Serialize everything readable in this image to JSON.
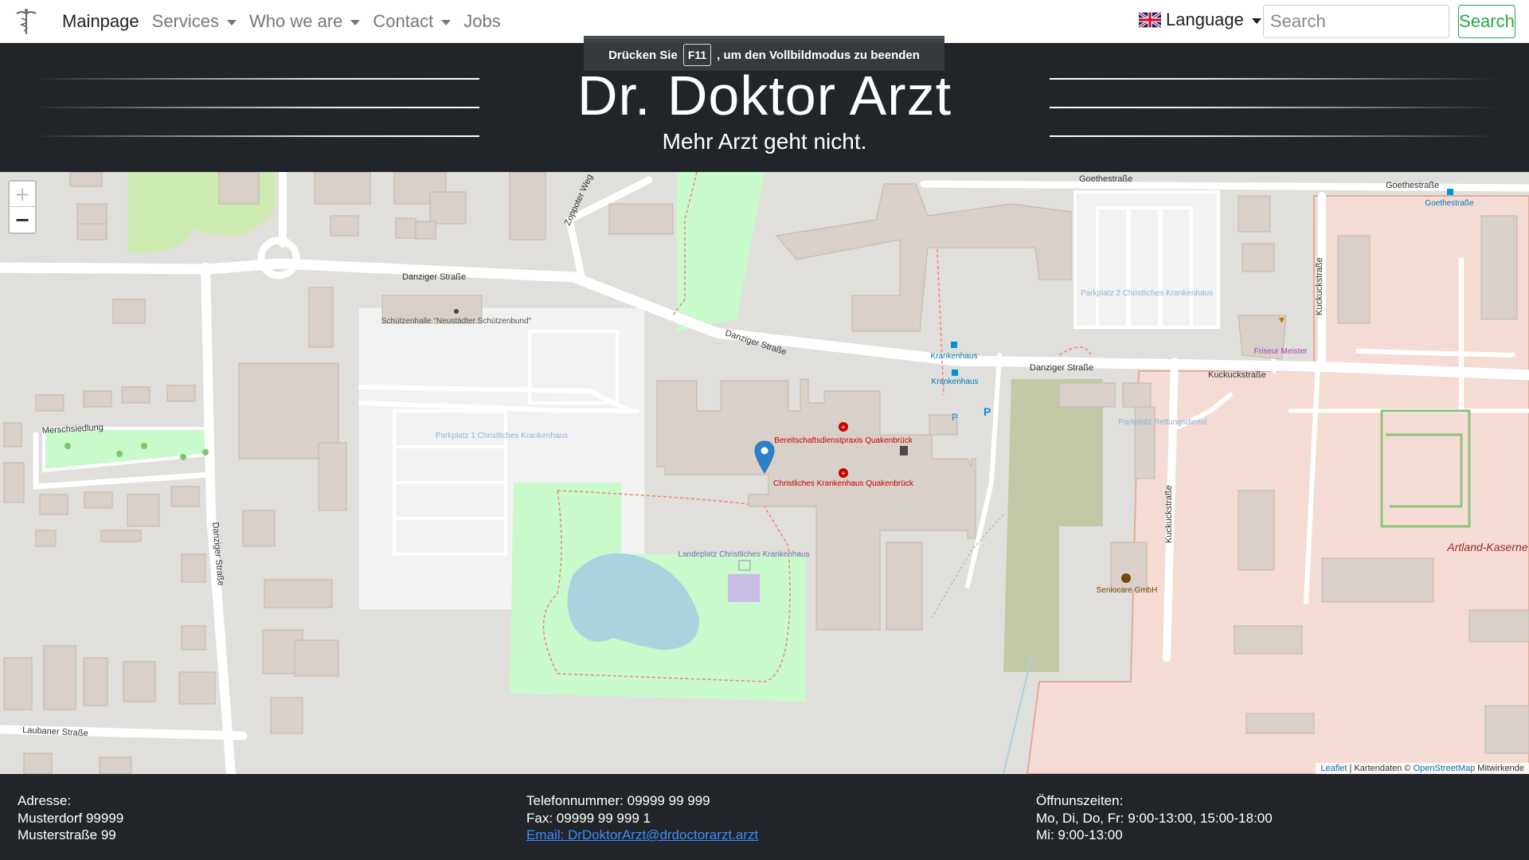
{
  "nav": {
    "brand_icon": "caduceus-icon",
    "items": [
      {
        "label": "Mainpage",
        "dropdown": false
      },
      {
        "label": "Services",
        "dropdown": true
      },
      {
        "label": "Who we are",
        "dropdown": true
      },
      {
        "label": "Contact",
        "dropdown": true
      },
      {
        "label": "Jobs",
        "dropdown": false
      }
    ],
    "language_label": "Language",
    "language_icon": "uk-flag-icon",
    "search_placeholder": "Search",
    "search_button": "Search"
  },
  "fullscreen_hint": {
    "before": "Drücken Sie",
    "key": "F11",
    "after": ", um den Vollbildmodus zu beenden"
  },
  "header": {
    "title": "Dr. Doktor Arzt",
    "subtitle": "Mehr Arzt geht nicht."
  },
  "map": {
    "zoom_in": "+",
    "zoom_out": "−",
    "marker_icon": "map-marker-icon",
    "labels": {
      "goethestrasse": "Goethestraße",
      "goethestrasse_stop": "Goethestraße",
      "danziger_strasse": "Danziger Straße",
      "zoppoter_weg": "Zoppoter Weg",
      "kuckuckstrasse": "Kuckuckstraße",
      "merschsiedlung": "Merschsiedlung",
      "laubaner_strasse": "Laubaner Straße",
      "schuetzenhalle": "Schützenhalle \"Neustädter Schützenbund\"",
      "parkplatz_1": "Parkplatz 1 Christliches Krankenhaus",
      "parkplatz_2": "Parkplatz 2 Christliches Krankenhaus",
      "parkplatz_rettung": "Parkplatz Rettungsdienst",
      "krankenhaus_stop": "Krankenhaus",
      "bereitschaft": "Bereitschaftsdienstpraxis Quakenbrück",
      "christliches_kh": "Christliches Krankenhaus Quakenbrück",
      "landeplatz": "Landeplatz Christliches Krankenhaus",
      "friseur": "Friseur Meister",
      "seniocare": "Seniocare GmbH",
      "kaserne": "Artland-Kaserne"
    },
    "attribution": {
      "leaflet": "Leaflet",
      "text": " | Kartendaten © ",
      "osm": "OpenStreetMap",
      "tail": " Mitwirkende"
    }
  },
  "footer": {
    "address_label": "Adresse:",
    "address_line1": "Musterdorf 99999",
    "address_line2": "Musterstraße 99",
    "phone": "Telefonnummer: 09999 99 999",
    "fax": "Fax: 09999 99 999 1",
    "email": "Email: DrDoktorArzt@drdoctorarzt.arzt",
    "hours_label": "Öffnunszeiten:",
    "hours_line1": "Mo, Di, Do, Fr: 9:00-13:00, 15:00-18:00",
    "hours_line2": "Mi: 9:00-13:00"
  }
}
